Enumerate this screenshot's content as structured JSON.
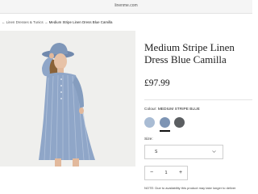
{
  "browser": {
    "url": "linenme.com"
  },
  "breadcrumb": {
    "parent": "Linen Dresses & Tunics",
    "separator": "→",
    "current": "Medium Stripe Linen Dress Blue Camilla"
  },
  "product": {
    "title": "Medium Stripe Linen Dress Blue Camilla",
    "price": "£97.99",
    "colour_label": "Colour:",
    "colour_value": "MEDIUM STRIPE BLUE",
    "swatches": [
      {
        "name": "light-blue",
        "color": "#a9bcd4"
      },
      {
        "name": "medium-stripe-blue",
        "color": "#7d94b4",
        "selected": true
      },
      {
        "name": "dark-grey",
        "color": "#5b5e61"
      }
    ],
    "size_label": "Size:",
    "size_value": "S",
    "quantity": {
      "minus": "−",
      "value": "1",
      "plus": "+"
    },
    "note": "NOTE: Due to availability this product may take longer to deliver"
  },
  "colors": {
    "dress": "#8fa6c8",
    "hat": "#7189ad",
    "background": "#efefed"
  }
}
